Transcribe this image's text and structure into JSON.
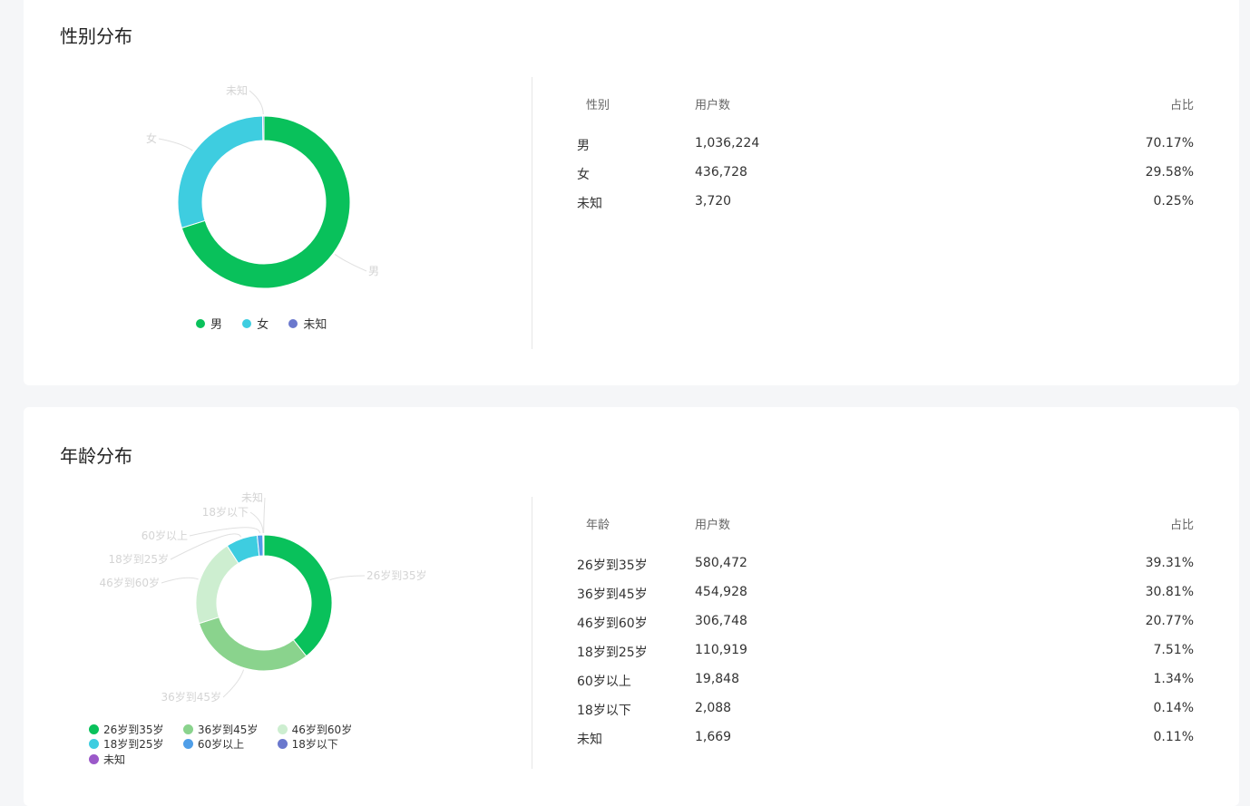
{
  "colors": {
    "male": "#09c15b",
    "female": "#3ecde0",
    "unknown": "#6a78cd",
    "age_26_35": "#09c15b",
    "age_36_45": "#8ad38d",
    "age_46_60": "#cdeed0",
    "age_18_25": "#3ecde0",
    "age_60_plus": "#4f9ee8",
    "age_under_18": "#6a78cd",
    "age_unknown": "#9b59c9"
  },
  "gender": {
    "title": "性别分布",
    "table_headers": {
      "category": "性别",
      "users": "用户数",
      "share": "占比"
    },
    "legend_items": [
      "男",
      "女",
      "未知"
    ],
    "rows": [
      {
        "label": "男",
        "users": "1,036,224",
        "share": "70.17%"
      },
      {
        "label": "女",
        "users": "436,728",
        "share": "29.58%"
      },
      {
        "label": "未知",
        "users": "3,720",
        "share": "0.25%"
      }
    ],
    "chart_data": {
      "type": "pie",
      "title": "",
      "labels": [
        "男",
        "女",
        "未知"
      ],
      "values": [
        1036224,
        436728,
        3720
      ],
      "percentages": [
        70.17,
        29.58,
        0.25
      ],
      "legend_position": "bottom"
    }
  },
  "age": {
    "title": "年龄分布",
    "table_headers": {
      "category": "年龄",
      "users": "用户数",
      "share": "占比"
    },
    "legend_items": [
      "26岁到35岁",
      "36岁到45岁",
      "46岁到60岁",
      "18岁到25岁",
      "60岁以上",
      "18岁以下",
      "未知"
    ],
    "rows": [
      {
        "label": "26岁到35岁",
        "users": "580,472",
        "share": "39.31%"
      },
      {
        "label": "36岁到45岁",
        "users": "454,928",
        "share": "30.81%"
      },
      {
        "label": "46岁到60岁",
        "users": "306,748",
        "share": "20.77%"
      },
      {
        "label": "18岁到25岁",
        "users": "110,919",
        "share": "7.51%"
      },
      {
        "label": "60岁以上",
        "users": "19,848",
        "share": "1.34%"
      },
      {
        "label": "18岁以下",
        "users": "2,088",
        "share": "0.14%"
      },
      {
        "label": "未知",
        "users": "1,669",
        "share": "0.11%"
      }
    ],
    "chart_data": {
      "type": "pie",
      "title": "",
      "labels": [
        "26岁到35岁",
        "36岁到45岁",
        "46岁到60岁",
        "18岁到25岁",
        "60岁以上",
        "18岁以下",
        "未知"
      ],
      "values": [
        580472,
        454928,
        306748,
        110919,
        19848,
        2088,
        1669
      ],
      "percentages": [
        39.31,
        30.81,
        20.77,
        7.51,
        1.34,
        0.14,
        0.11
      ],
      "legend_position": "bottom"
    }
  }
}
